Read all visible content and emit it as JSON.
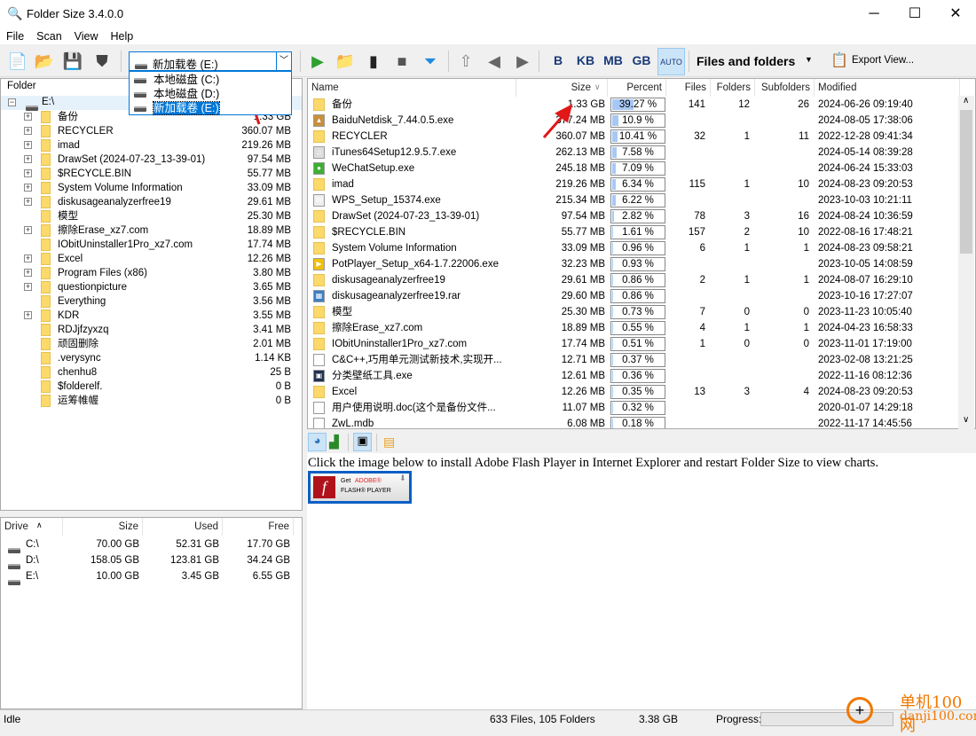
{
  "window": {
    "title": "Folder Size 3.4.0.0",
    "minimize": "─",
    "maximize": "☐",
    "close": "✕"
  },
  "menu": [
    "File",
    "Scan",
    "View",
    "Help"
  ],
  "toolbar": {
    "drive_selected": "新加载卷 (E:)",
    "drive_options": [
      "本地磁盘 (C:)",
      "本地磁盘 (D:)",
      "新加载卷 (E:)"
    ],
    "units": [
      "B",
      "KB",
      "MB",
      "GB",
      "AUTO"
    ],
    "view_mode": "Files and folders",
    "export": "Export View..."
  },
  "tree": {
    "header": "Folder",
    "root": "E:\\",
    "items": [
      [
        "备份",
        "1.33 GB",
        true
      ],
      [
        "RECYCLER",
        "360.07 MB",
        true
      ],
      [
        "imad",
        "219.26 MB",
        true
      ],
      [
        "DrawSet (2024-07-23_13-39-01)",
        "97.54 MB",
        true
      ],
      [
        "$RECYCLE.BIN",
        "55.77 MB",
        true
      ],
      [
        "System Volume Information",
        "33.09 MB",
        true
      ],
      [
        "diskusageanalyzerfree19",
        "29.61 MB",
        true
      ],
      [
        "模型",
        "25.30 MB",
        false
      ],
      [
        "擦除Erase_xz7.com",
        "18.89 MB",
        true
      ],
      [
        "IObitUninstaller1Pro_xz7.com",
        "17.74 MB",
        false
      ],
      [
        "Excel",
        "12.26 MB",
        true
      ],
      [
        "Program Files (x86)",
        "3.80 MB",
        true
      ],
      [
        "questionpicture",
        "3.65 MB",
        true
      ],
      [
        "Everything",
        "3.56 MB",
        false
      ],
      [
        "KDR",
        "3.55 MB",
        true
      ],
      [
        "RDJjfzyxzq",
        "3.41 MB",
        false
      ],
      [
        "顽固删除",
        "2.01 MB",
        false
      ],
      [
        ".verysync",
        "1.14 KB",
        false
      ],
      [
        "chenhu8",
        "25 B",
        false
      ],
      [
        "$folderelf.",
        "0 B",
        false
      ],
      [
        "运筹帷幄",
        "0 B",
        false
      ]
    ]
  },
  "drives": {
    "headers": [
      "Drive",
      "Size",
      "Used",
      "Free"
    ],
    "rows": [
      [
        "C:\\",
        "70.00 GB",
        "52.31 GB",
        "17.70 GB"
      ],
      [
        "D:\\",
        "158.05 GB",
        "123.81 GB",
        "34.24 GB"
      ],
      [
        "E:\\",
        "10.00 GB",
        "3.45 GB",
        "6.55 GB"
      ]
    ]
  },
  "list": {
    "headers": [
      "Name",
      "Size",
      "Percent",
      "Files",
      "Folders",
      "Subfolders",
      "Modified"
    ],
    "rows": [
      [
        "folder",
        "备份",
        "1.33 GB",
        39.27,
        "39.27 %",
        "141",
        "12",
        "26",
        "2024-06-26 09:19:40"
      ],
      [
        "exe-baidu",
        "BaiduNetdisk_7.44.0.5.exe",
        "377.24 MB",
        10.9,
        "10.9 %",
        "",
        "",
        "",
        "2024-08-05 17:38:06"
      ],
      [
        "folder",
        "RECYCLER",
        "360.07 MB",
        10.41,
        "10.41 %",
        "32",
        "1",
        "11",
        "2022-12-28 09:41:34"
      ],
      [
        "exe-itunes",
        "iTunes64Setup12.9.5.7.exe",
        "262.13 MB",
        7.58,
        "7.58 %",
        "",
        "",
        "",
        "2024-05-14 08:39:28"
      ],
      [
        "exe-wechat",
        "WeChatSetup.exe",
        "245.18 MB",
        7.09,
        "7.09 %",
        "",
        "",
        "",
        "2024-06-24 15:33:03"
      ],
      [
        "folder",
        "imad",
        "219.26 MB",
        6.34,
        "6.34 %",
        "115",
        "1",
        "10",
        "2024-08-23 09:20:53"
      ],
      [
        "exe-wps",
        "WPS_Setup_15374.exe",
        "215.34 MB",
        6.22,
        "6.22 %",
        "",
        "",
        "",
        "2023-10-03 10:21:11"
      ],
      [
        "folder",
        "DrawSet (2024-07-23_13-39-01)",
        "97.54 MB",
        2.82,
        "2.82 %",
        "78",
        "3",
        "16",
        "2024-08-24 10:36:59"
      ],
      [
        "folder",
        "$RECYCLE.BIN",
        "55.77 MB",
        1.61,
        "1.61 %",
        "157",
        "2",
        "10",
        "2022-08-16 17:48:21"
      ],
      [
        "folder",
        "System Volume Information",
        "33.09 MB",
        0.96,
        "0.96 %",
        "6",
        "1",
        "1",
        "2024-08-23 09:58:21"
      ],
      [
        "exe-potplayer",
        "PotPlayer_Setup_x64-1.7.22006.exe",
        "32.23 MB",
        0.93,
        "0.93 %",
        "",
        "",
        "",
        "2023-10-05 14:08:59"
      ],
      [
        "folder",
        "diskusageanalyzerfree19",
        "29.61 MB",
        0.86,
        "0.86 %",
        "2",
        "1",
        "1",
        "2024-08-07 16:29:10"
      ],
      [
        "rar",
        "diskusageanalyzerfree19.rar",
        "29.60 MB",
        0.86,
        "0.86 %",
        "",
        "",
        "",
        "2023-10-16 17:27:07"
      ],
      [
        "folder",
        "模型",
        "25.30 MB",
        0.73,
        "0.73 %",
        "7",
        "0",
        "0",
        "2023-11-23 10:05:40"
      ],
      [
        "folder",
        "擦除Erase_xz7.com",
        "18.89 MB",
        0.55,
        "0.55 %",
        "4",
        "1",
        "1",
        "2024-04-23 16:58:33"
      ],
      [
        "folder",
        "IObitUninstaller1Pro_xz7.com",
        "17.74 MB",
        0.51,
        "0.51 %",
        "1",
        "0",
        "0",
        "2023-11-01 17:19:00"
      ],
      [
        "pdf",
        "C&C++,巧用单元测试新技术,实现开...",
        "12.71 MB",
        0.37,
        "0.37 %",
        "",
        "",
        "",
        "2023-02-08 13:21:25"
      ],
      [
        "exe-app",
        "分类壁纸工具.exe",
        "12.61 MB",
        0.36,
        "0.36 %",
        "",
        "",
        "",
        "2022-11-16 08:12:36"
      ],
      [
        "folder",
        "Excel",
        "12.26 MB",
        0.35,
        "0.35 %",
        "13",
        "3",
        "4",
        "2024-08-23 09:20:53"
      ],
      [
        "file",
        "用户使用说明.doc(这个是备份文件...",
        "11.07 MB",
        0.32,
        "0.32 %",
        "",
        "",
        "",
        "2020-01-07 14:29:18"
      ],
      [
        "file",
        "ZwL.mdb",
        "6.08 MB",
        0.18,
        "0.18 %",
        "",
        "",
        "",
        "2022-11-17 14:45:56"
      ]
    ]
  },
  "chart": {
    "message": "Click the image below to install Adobe Flash Player in Internet Explorer and restart Folder Size to view charts.",
    "flash_get": "Get",
    "flash_adobe": "ADOBE®",
    "flash_player": "FLASH® PLAYER"
  },
  "status": {
    "state": "Idle",
    "counts": "633 Files, 105 Folders",
    "total": "3.38 GB",
    "progress_label": "Progress:"
  },
  "watermark": {
    "text": "单机100网",
    "url": "danji100.com"
  },
  "colors": {
    "accent": "#0078d7",
    "percent_bar": "#a8c8f4",
    "folder": "#fbd96a",
    "arrow": "#e01818"
  }
}
